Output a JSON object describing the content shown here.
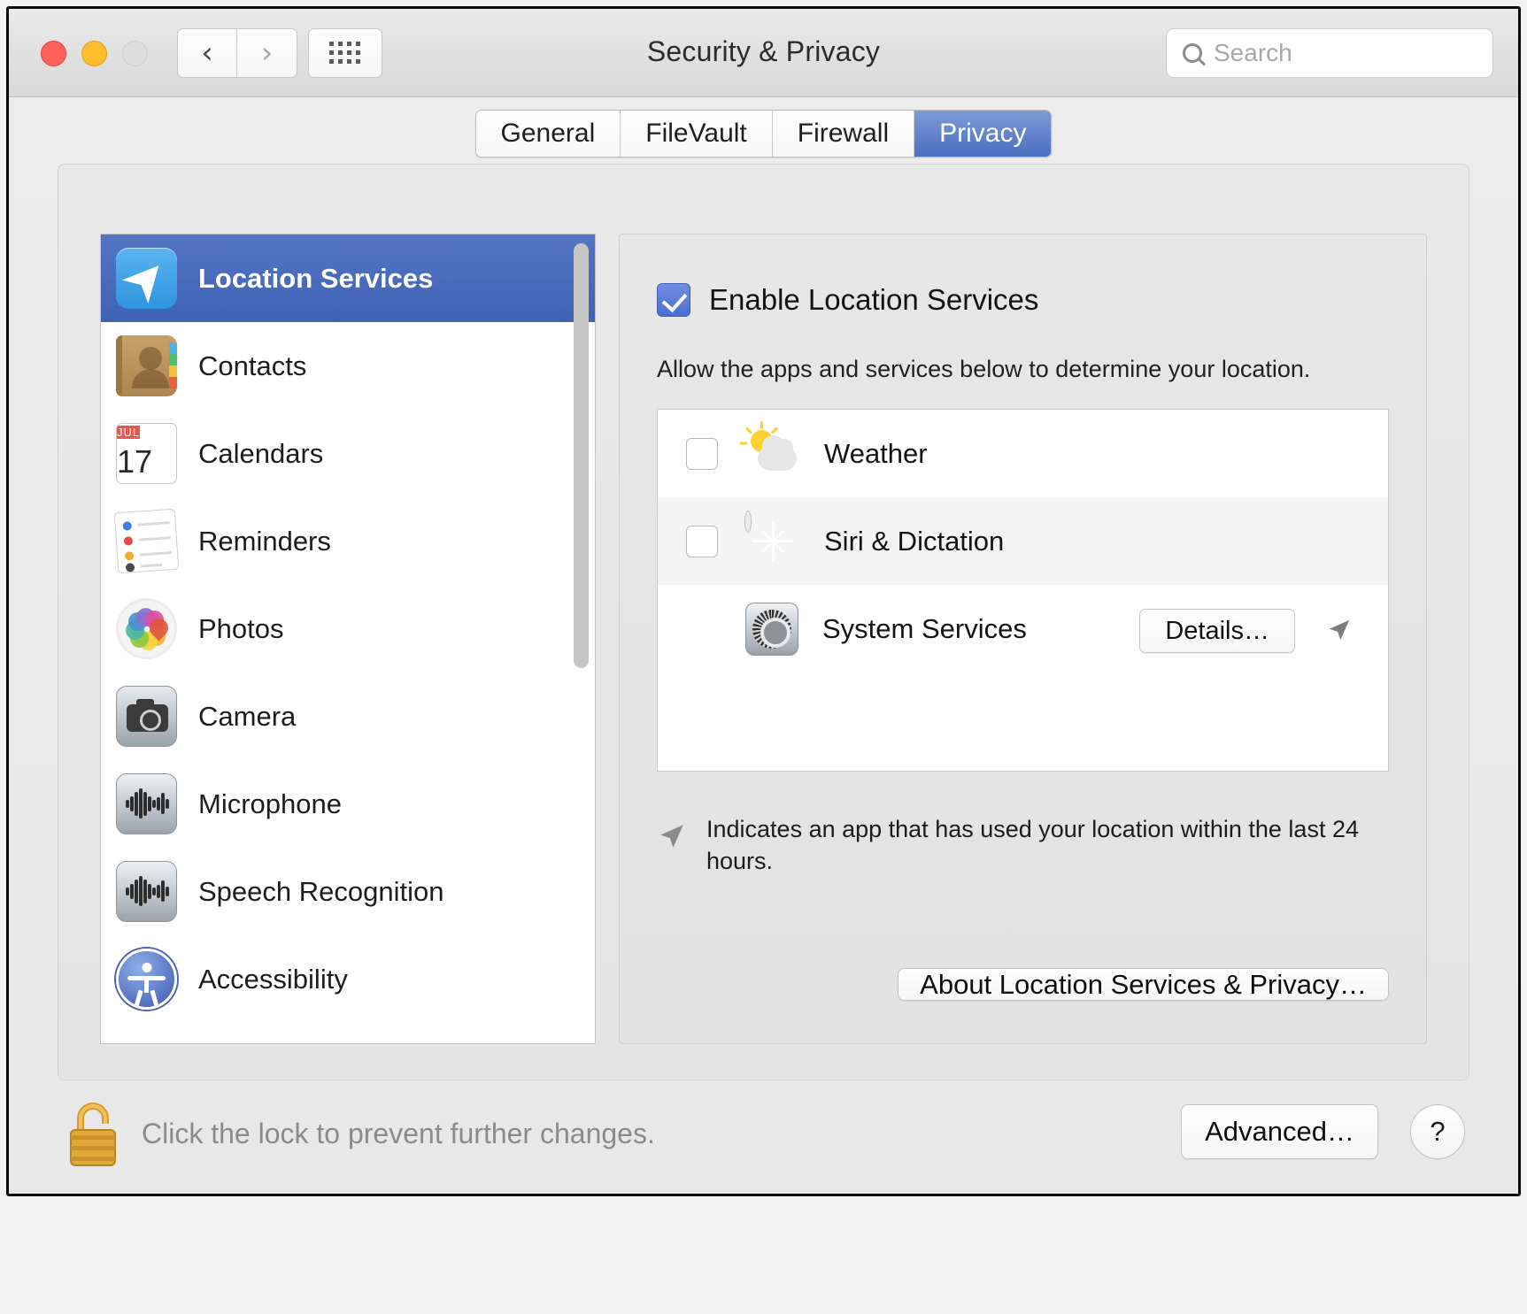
{
  "window": {
    "title": "Security & Privacy",
    "traffic_lights": [
      "close",
      "minimize",
      "zoom"
    ],
    "nav": {
      "back": "‹",
      "forward": "›",
      "grid": "grid-icon"
    },
    "search": {
      "placeholder": "Search",
      "value": ""
    }
  },
  "tabs": [
    {
      "label": "General",
      "active": false
    },
    {
      "label": "FileVault",
      "active": false
    },
    {
      "label": "Firewall",
      "active": false
    },
    {
      "label": "Privacy",
      "active": true
    }
  ],
  "sidebar": {
    "items": [
      {
        "label": "Location Services",
        "icon": "location-services-icon",
        "selected": true
      },
      {
        "label": "Contacts",
        "icon": "contacts-icon",
        "selected": false
      },
      {
        "label": "Calendars",
        "icon": "calendars-icon",
        "selected": false
      },
      {
        "label": "Reminders",
        "icon": "reminders-icon",
        "selected": false
      },
      {
        "label": "Photos",
        "icon": "photos-icon",
        "selected": false
      },
      {
        "label": "Camera",
        "icon": "camera-icon",
        "selected": false
      },
      {
        "label": "Microphone",
        "icon": "microphone-icon",
        "selected": false
      },
      {
        "label": "Speech Recognition",
        "icon": "speech-recognition-icon",
        "selected": false
      },
      {
        "label": "Accessibility",
        "icon": "accessibility-icon",
        "selected": false
      }
    ],
    "calendar_icon": {
      "month": "JUL",
      "day": "17"
    }
  },
  "detail": {
    "enable_checkbox_label": "Enable Location Services",
    "enable_checkbox_checked": true,
    "allow_text": "Allow the apps and services below to determine your location.",
    "apps": [
      {
        "label": "Weather",
        "icon": "weather-icon",
        "checked": false,
        "has_checkbox": true,
        "has_details": false,
        "recent": false
      },
      {
        "label": "Siri & Dictation",
        "icon": "siri-icon",
        "checked": false,
        "has_checkbox": true,
        "has_details": false,
        "recent": false
      },
      {
        "label": "System Services",
        "icon": "system-services-gear-icon",
        "checked": false,
        "has_checkbox": false,
        "has_details": true,
        "details_label": "Details…",
        "recent": true
      }
    ],
    "note_text": "Indicates an app that has used your location within the last 24 hours.",
    "about_button": "About Location Services & Privacy…"
  },
  "bottom": {
    "lock_icon": "unlocked-padlock-icon",
    "lock_text": "Click the lock to prevent further changes.",
    "advanced_button": "Advanced…",
    "help_button": "?"
  },
  "colors": {
    "accent_blue": "#4a6fc0",
    "selection_blue": "#4665b8",
    "checkbox_blue": "#5078d8",
    "window_bg": "#e8e8e8"
  }
}
